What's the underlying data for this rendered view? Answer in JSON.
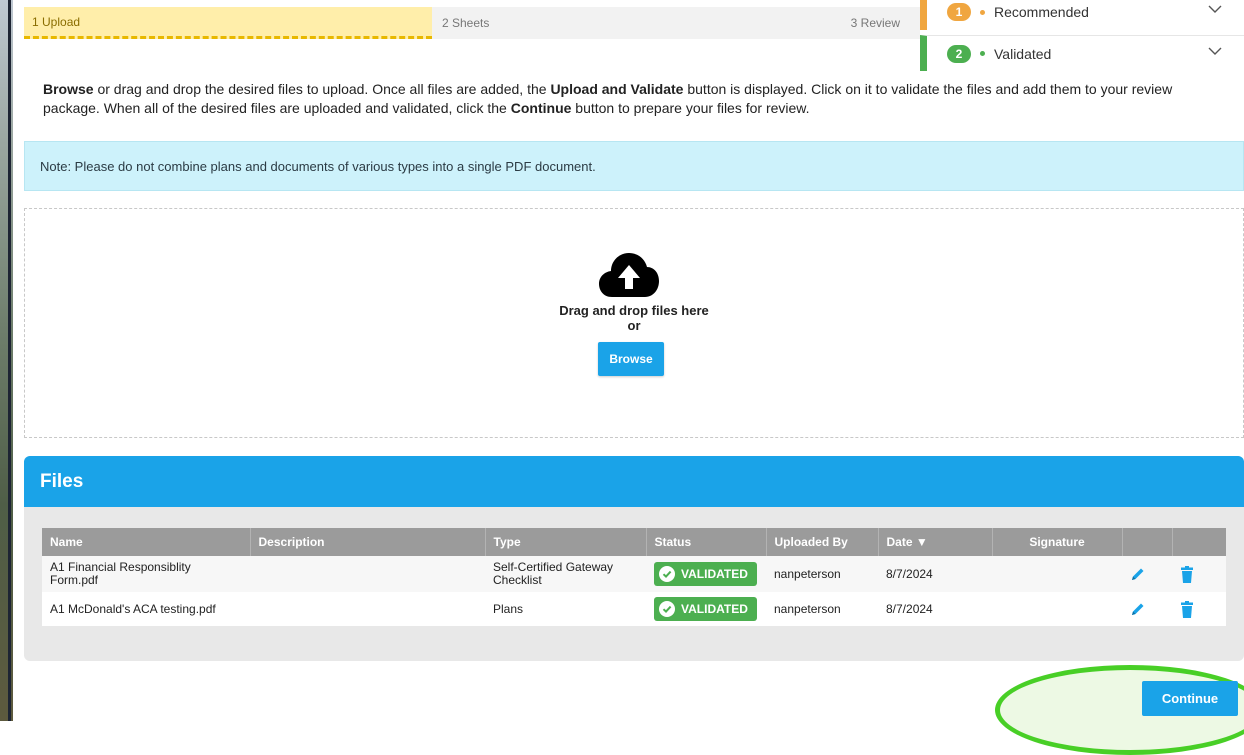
{
  "stepper": {
    "steps": [
      {
        "label": "1 Upload"
      },
      {
        "label": "2 Sheets"
      },
      {
        "label": "3 Review"
      }
    ]
  },
  "legend": {
    "items": [
      {
        "number": "1",
        "label": "Recommended",
        "color": "#f0a640"
      },
      {
        "number": "2",
        "label": "Validated",
        "color": "#4caf50"
      }
    ]
  },
  "instructions": {
    "browse": "Browse",
    "part1": " or drag and drop the desired files to upload. Once all files are added, the ",
    "upload_validate": "Upload and Validate",
    "part2": " button is displayed. Click on it to validate the files and add them to your review package. When all of the desired files are uploaded and validated, click the ",
    "continue": "Continue",
    "part3": " button to prepare your files for review."
  },
  "note": "Note: Please do not combine plans and documents of various types into a single PDF document.",
  "dropzone": {
    "line1": "Drag and drop files here",
    "line2": "or",
    "browse_label": "Browse"
  },
  "files": {
    "title": "Files",
    "columns": [
      "Name",
      "Description",
      "Type",
      "Status",
      "Uploaded By",
      "Date ▼",
      "Signature",
      "",
      ""
    ],
    "rows": [
      {
        "name": "A1 Financial Responsiblity Form.pdf",
        "description": "",
        "type": "Self-Certified Gateway Checklist",
        "status": "VALIDATED",
        "uploaded_by": "nanpeterson",
        "date": "8/7/2024",
        "signature": ""
      },
      {
        "name": "A1 McDonald's ACA testing.pdf",
        "description": "",
        "type": "Plans",
        "status": "VALIDATED",
        "uploaded_by": "nanpeterson",
        "date": "8/7/2024",
        "signature": ""
      }
    ]
  },
  "continue_label": "Continue",
  "colors": {
    "accent": "#1aa3e8",
    "validated": "#4caf50",
    "recommended": "#f0a640",
    "highlight": "#48cf26"
  }
}
